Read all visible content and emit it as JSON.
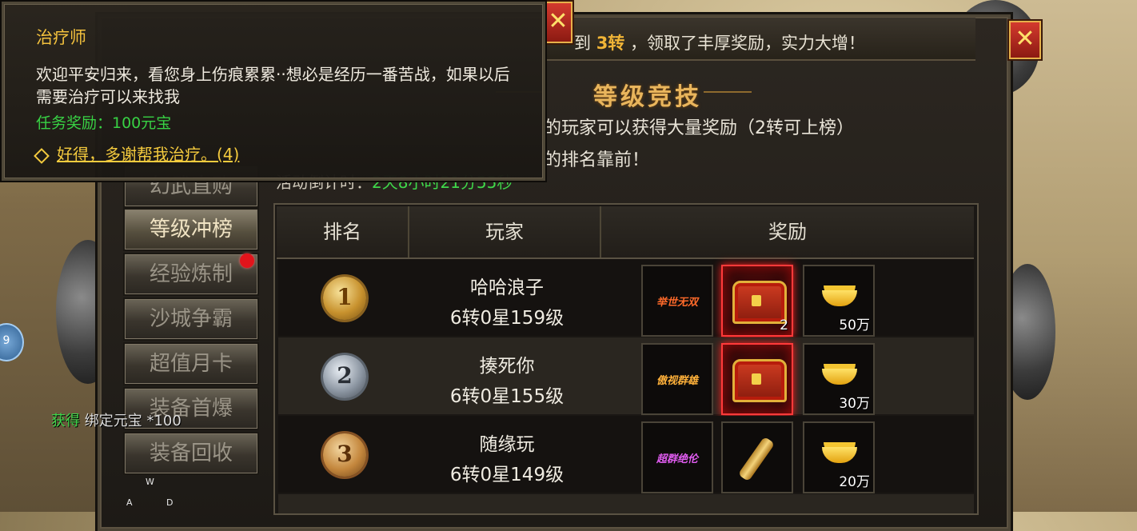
{
  "announcement": {
    "prefix": "到",
    "highlight": "3转",
    "suffix": "，领取了丰厚奖励，实力大增！"
  },
  "panel": {
    "title": "等级竞技",
    "desc_line1": "的玩家可以获得大量奖励（2转可上榜）",
    "desc_line2": "的排名靠前！",
    "countdown_label": "活动倒计时：",
    "countdown_value": "2天8小时21分55秒"
  },
  "sidebar": {
    "items": [
      {
        "label": "幻武直购"
      },
      {
        "label": "等级冲榜"
      },
      {
        "label": "经验炼制"
      },
      {
        "label": "沙城争霸"
      },
      {
        "label": "超值月卡"
      },
      {
        "label": "装备首爆"
      },
      {
        "label": "装备回收"
      }
    ]
  },
  "table": {
    "headers": {
      "rank": "排名",
      "player": "玩家",
      "reward": "奖励"
    },
    "rows": [
      {
        "rank": "1",
        "name": "哈哈浪子",
        "level": "6转0星159级",
        "title_item": "举世无双",
        "item2_qty": "2",
        "ingot_amount": "50万"
      },
      {
        "rank": "2",
        "name": "揍死你",
        "level": "6转0星155级",
        "title_item": "傲视群雄",
        "item2_qty": "",
        "ingot_amount": "30万"
      },
      {
        "rank": "3",
        "name": "随缘玩",
        "level": "6转0星149级",
        "title_item": "超群绝伦",
        "item2_qty": "",
        "ingot_amount": "20万"
      }
    ]
  },
  "tooltip": {
    "title": "治疗师",
    "body": "欢迎平安归来，看您身上伤痕累累··想必是经历一番苦战，如果以后需要治疗可以来找我",
    "reward": "任务奖励：100元宝",
    "option": "好得，多谢帮我治疗。(4)"
  },
  "hud": {
    "gain_prefix": "获得",
    "gain_text": " 绑定元宝 *100",
    "side_badge": "9",
    "key_w": "W",
    "key_a": "A",
    "key_d": "D"
  },
  "colors": {
    "gold": "#f0b437",
    "green": "#3fd84a",
    "close_red": "#d33a2e"
  }
}
